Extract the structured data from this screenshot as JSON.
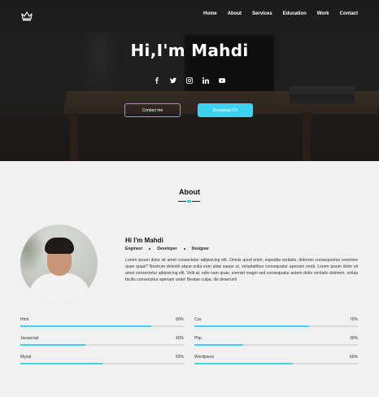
{
  "nav": {
    "logo_icon": "crown-icon",
    "items": [
      "Home",
      "About",
      "Services",
      "Education",
      "Work",
      "Contact"
    ]
  },
  "hero": {
    "title": "Hi,I'm Mahdi",
    "socials": [
      "facebook-icon",
      "twitter-icon",
      "instagram-icon",
      "linkedin-icon",
      "youtube-icon"
    ],
    "contact_button": "Contact me",
    "download_button": "Download CV"
  },
  "about": {
    "title": "About",
    "name": "Hi I'm Mahdi",
    "roles": [
      "Engineer",
      "Developer",
      "Designer"
    ],
    "bio": "Lorem ipsum dolor sit amet consectetur adipisicing elit. Omnis quod enim, expedita veritatis, dolorum consequuntur eventore quae quasi? Nostrum deleniti atque nulla eum alias saepe ut, voluptatibus consequatur aperiam modi. Lorem ipsum dolor sit amet consectetur adipisicing elit. Velit at, odio nam quae, eveniet magni sed consequatur autem dolor veritatis dolorem, soluta facilis consectetur aperiam unde! Beatae culpa, illo deserunt!"
  },
  "skills": [
    {
      "name": "Html",
      "percent_label": "80%",
      "value": 80
    },
    {
      "name": "Css",
      "percent_label": "70%",
      "value": 70
    },
    {
      "name": "Javascript",
      "percent_label": "40%",
      "value": 40
    },
    {
      "name": "Php",
      "percent_label": "30%",
      "value": 30
    },
    {
      "name": "Mysql",
      "percent_label": "50%",
      "value": 50
    },
    {
      "name": "Wordpress",
      "percent_label": "60%",
      "value": 60
    }
  ],
  "colors": {
    "accent": "#3ed2f2",
    "track": "#dadada"
  }
}
